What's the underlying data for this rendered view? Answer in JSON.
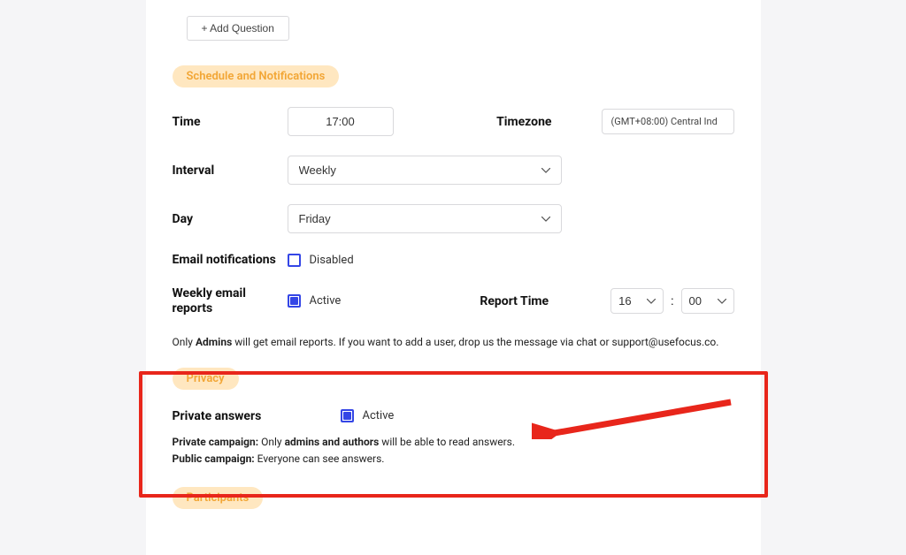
{
  "add_question_label": "+ Add Question",
  "sections": {
    "schedule_title": "Schedule and Notifications",
    "privacy_title": "Privacy",
    "participants_title": "Participants"
  },
  "schedule": {
    "time_label": "Time",
    "time_value": "17:00",
    "timezone_label": "Timezone",
    "timezone_value": "(GMT+08:00) Central Ind",
    "interval_label": "Interval",
    "interval_value": "Weekly",
    "day_label": "Day",
    "day_value": "Friday",
    "email_notif_label": "Email notifications",
    "email_notif_checked": false,
    "email_notif_state": "Disabled",
    "weekly_reports_label": "Weekly email reports",
    "weekly_reports_checked": true,
    "weekly_reports_state": "Active",
    "report_time_label": "Report Time",
    "report_hour": "16",
    "report_minute": "00",
    "admin_note_prefix": "Only ",
    "admin_note_bold": "Admins",
    "admin_note_suffix": " will get email reports. If you want to add a user, drop us the message via chat or support@usefocus.co."
  },
  "privacy": {
    "private_answers_label": "Private answers",
    "private_answers_checked": true,
    "private_answers_state": "Active",
    "line1_bold1": "Private campaign:",
    "line1_text1": " Only ",
    "line1_bold2": "admins and authors",
    "line1_text2": " will be able to read answers.",
    "line2_bold": "Public campaign:",
    "line2_text": " Everyone can see answers."
  }
}
